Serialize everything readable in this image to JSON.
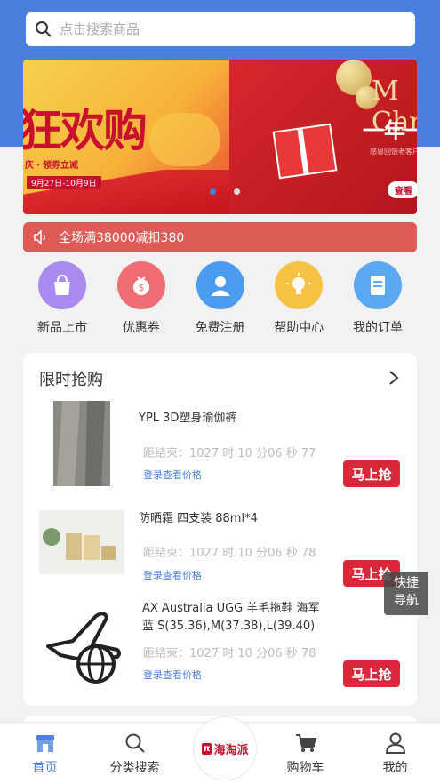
{
  "search": {
    "placeholder": "点击搜索商品"
  },
  "banner": {
    "slide1": {
      "headline": "狂欢购",
      "sub": "庆・领券立减",
      "date": "9月27日-10月9日"
    },
    "slide2": {
      "headline_en": "M Chr",
      "headline": "一年一度",
      "sub": "感恩回馈老客户",
      "cta": "查看"
    }
  },
  "notice": {
    "text": "全场满38000减扣380"
  },
  "nav": [
    {
      "label": "新品上市",
      "icon": "shopping-bag-icon",
      "color": "#a98af0"
    },
    {
      "label": "优惠券",
      "icon": "money-bag-icon",
      "color": "#f06d74"
    },
    {
      "label": "免费注册",
      "icon": "user-icon",
      "color": "#4a9cf0"
    },
    {
      "label": "帮助中心",
      "icon": "lightbulb-icon",
      "color": "#f7c244"
    },
    {
      "label": "我的订单",
      "icon": "order-icon",
      "color": "#5aa9f0"
    }
  ],
  "flash_sale": {
    "title": "限时抢购",
    "items": [
      {
        "name": "YPL 3D塑身瑜伽裤",
        "timer": "距结束：1027 时 10 分06 秒 77",
        "login": "登录查看价格",
        "button": "马上抢"
      },
      {
        "name": "防晒霜 四支装 88ml*4",
        "timer": "距结束：1027 时 10 分06 秒 78",
        "login": "登录查看价格",
        "button": "马上抢"
      },
      {
        "name": "AX Australia UGG 羊毛拖鞋 海军蓝 S(35.36),M(37.38),L(39.40)",
        "timer": "距结束：1027 时 10 分06 秒 78",
        "login": "登录查看价格",
        "button": "马上抢"
      }
    ]
  },
  "quick_nav": {
    "line1": "快捷",
    "line2": "导航"
  },
  "tabbar": {
    "home": "首页",
    "category": "分类搜索",
    "logo": "海淘派",
    "logo_mark": "π",
    "cart": "购物车",
    "mine": "我的"
  },
  "colors": {
    "brand": "#4a7fe0",
    "notice": "#de5b57",
    "button": "#d8283a"
  }
}
